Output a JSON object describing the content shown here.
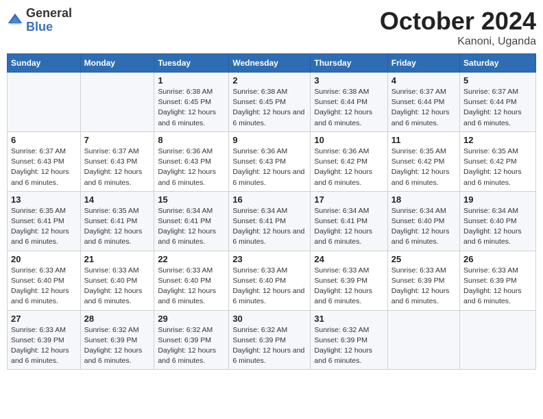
{
  "logo": {
    "general": "General",
    "blue": "Blue"
  },
  "title": "October 2024",
  "subtitle": "Kanoni, Uganda",
  "days_of_week": [
    "Sunday",
    "Monday",
    "Tuesday",
    "Wednesday",
    "Thursday",
    "Friday",
    "Saturday"
  ],
  "weeks": [
    [
      null,
      null,
      {
        "day": "1",
        "sunrise": "Sunrise: 6:38 AM",
        "sunset": "Sunset: 6:45 PM",
        "daylight": "Daylight: 12 hours and 6 minutes."
      },
      {
        "day": "2",
        "sunrise": "Sunrise: 6:38 AM",
        "sunset": "Sunset: 6:45 PM",
        "daylight": "Daylight: 12 hours and 6 minutes."
      },
      {
        "day": "3",
        "sunrise": "Sunrise: 6:38 AM",
        "sunset": "Sunset: 6:44 PM",
        "daylight": "Daylight: 12 hours and 6 minutes."
      },
      {
        "day": "4",
        "sunrise": "Sunrise: 6:37 AM",
        "sunset": "Sunset: 6:44 PM",
        "daylight": "Daylight: 12 hours and 6 minutes."
      },
      {
        "day": "5",
        "sunrise": "Sunrise: 6:37 AM",
        "sunset": "Sunset: 6:44 PM",
        "daylight": "Daylight: 12 hours and 6 minutes."
      }
    ],
    [
      {
        "day": "6",
        "sunrise": "Sunrise: 6:37 AM",
        "sunset": "Sunset: 6:43 PM",
        "daylight": "Daylight: 12 hours and 6 minutes."
      },
      {
        "day": "7",
        "sunrise": "Sunrise: 6:37 AM",
        "sunset": "Sunset: 6:43 PM",
        "daylight": "Daylight: 12 hours and 6 minutes."
      },
      {
        "day": "8",
        "sunrise": "Sunrise: 6:36 AM",
        "sunset": "Sunset: 6:43 PM",
        "daylight": "Daylight: 12 hours and 6 minutes."
      },
      {
        "day": "9",
        "sunrise": "Sunrise: 6:36 AM",
        "sunset": "Sunset: 6:43 PM",
        "daylight": "Daylight: 12 hours and 6 minutes."
      },
      {
        "day": "10",
        "sunrise": "Sunrise: 6:36 AM",
        "sunset": "Sunset: 6:42 PM",
        "daylight": "Daylight: 12 hours and 6 minutes."
      },
      {
        "day": "11",
        "sunrise": "Sunrise: 6:35 AM",
        "sunset": "Sunset: 6:42 PM",
        "daylight": "Daylight: 12 hours and 6 minutes."
      },
      {
        "day": "12",
        "sunrise": "Sunrise: 6:35 AM",
        "sunset": "Sunset: 6:42 PM",
        "daylight": "Daylight: 12 hours and 6 minutes."
      }
    ],
    [
      {
        "day": "13",
        "sunrise": "Sunrise: 6:35 AM",
        "sunset": "Sunset: 6:41 PM",
        "daylight": "Daylight: 12 hours and 6 minutes."
      },
      {
        "day": "14",
        "sunrise": "Sunrise: 6:35 AM",
        "sunset": "Sunset: 6:41 PM",
        "daylight": "Daylight: 12 hours and 6 minutes."
      },
      {
        "day": "15",
        "sunrise": "Sunrise: 6:34 AM",
        "sunset": "Sunset: 6:41 PM",
        "daylight": "Daylight: 12 hours and 6 minutes."
      },
      {
        "day": "16",
        "sunrise": "Sunrise: 6:34 AM",
        "sunset": "Sunset: 6:41 PM",
        "daylight": "Daylight: 12 hours and 6 minutes."
      },
      {
        "day": "17",
        "sunrise": "Sunrise: 6:34 AM",
        "sunset": "Sunset: 6:41 PM",
        "daylight": "Daylight: 12 hours and 6 minutes."
      },
      {
        "day": "18",
        "sunrise": "Sunrise: 6:34 AM",
        "sunset": "Sunset: 6:40 PM",
        "daylight": "Daylight: 12 hours and 6 minutes."
      },
      {
        "day": "19",
        "sunrise": "Sunrise: 6:34 AM",
        "sunset": "Sunset: 6:40 PM",
        "daylight": "Daylight: 12 hours and 6 minutes."
      }
    ],
    [
      {
        "day": "20",
        "sunrise": "Sunrise: 6:33 AM",
        "sunset": "Sunset: 6:40 PM",
        "daylight": "Daylight: 12 hours and 6 minutes."
      },
      {
        "day": "21",
        "sunrise": "Sunrise: 6:33 AM",
        "sunset": "Sunset: 6:40 PM",
        "daylight": "Daylight: 12 hours and 6 minutes."
      },
      {
        "day": "22",
        "sunrise": "Sunrise: 6:33 AM",
        "sunset": "Sunset: 6:40 PM",
        "daylight": "Daylight: 12 hours and 6 minutes."
      },
      {
        "day": "23",
        "sunrise": "Sunrise: 6:33 AM",
        "sunset": "Sunset: 6:40 PM",
        "daylight": "Daylight: 12 hours and 6 minutes."
      },
      {
        "day": "24",
        "sunrise": "Sunrise: 6:33 AM",
        "sunset": "Sunset: 6:39 PM",
        "daylight": "Daylight: 12 hours and 6 minutes."
      },
      {
        "day": "25",
        "sunrise": "Sunrise: 6:33 AM",
        "sunset": "Sunset: 6:39 PM",
        "daylight": "Daylight: 12 hours and 6 minutes."
      },
      {
        "day": "26",
        "sunrise": "Sunrise: 6:33 AM",
        "sunset": "Sunset: 6:39 PM",
        "daylight": "Daylight: 12 hours and 6 minutes."
      }
    ],
    [
      {
        "day": "27",
        "sunrise": "Sunrise: 6:33 AM",
        "sunset": "Sunset: 6:39 PM",
        "daylight": "Daylight: 12 hours and 6 minutes."
      },
      {
        "day": "28",
        "sunrise": "Sunrise: 6:32 AM",
        "sunset": "Sunset: 6:39 PM",
        "daylight": "Daylight: 12 hours and 6 minutes."
      },
      {
        "day": "29",
        "sunrise": "Sunrise: 6:32 AM",
        "sunset": "Sunset: 6:39 PM",
        "daylight": "Daylight: 12 hours and 6 minutes."
      },
      {
        "day": "30",
        "sunrise": "Sunrise: 6:32 AM",
        "sunset": "Sunset: 6:39 PM",
        "daylight": "Daylight: 12 hours and 6 minutes."
      },
      {
        "day": "31",
        "sunrise": "Sunrise: 6:32 AM",
        "sunset": "Sunset: 6:39 PM",
        "daylight": "Daylight: 12 hours and 6 minutes."
      },
      null,
      null
    ]
  ]
}
